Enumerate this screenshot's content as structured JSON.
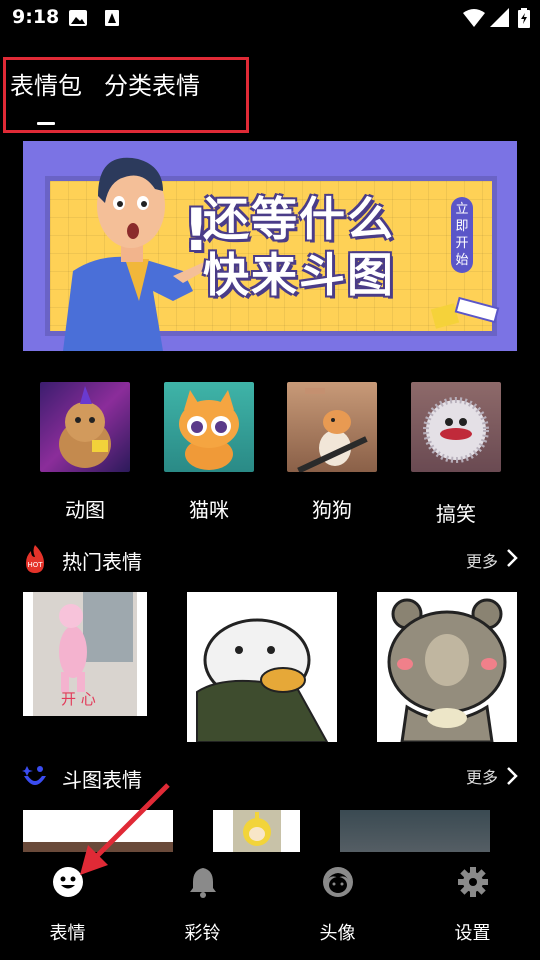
{
  "status_bar": {
    "time": "9:18"
  },
  "tabs": [
    {
      "label": "表情包",
      "active": true
    },
    {
      "label": "分类表情",
      "active": false
    }
  ],
  "banner": {
    "exclamation": "!",
    "line1": "还等什么",
    "line2": "快来斗图",
    "badge": "立即开始"
  },
  "categories": [
    {
      "label": "动图"
    },
    {
      "label": "猫咪"
    },
    {
      "label": "狗狗"
    },
    {
      "label": "搞笑"
    }
  ],
  "hot_section": {
    "title": "热门表情",
    "more": "更多",
    "badge": "HOT",
    "sticker_text": "开 心"
  },
  "battle_section": {
    "title": "斗图表情",
    "more": "更多"
  },
  "bottom_nav": [
    {
      "label": "表情",
      "icon": "smiley-icon"
    },
    {
      "label": "彩铃",
      "icon": "bell-icon"
    },
    {
      "label": "头像",
      "icon": "avatar-icon"
    },
    {
      "label": "设置",
      "icon": "gear-icon"
    }
  ],
  "colors": {
    "highlight": "#e02a36",
    "banner_bg": "#7b73e4",
    "banner_panel": "#fed156",
    "hot_icon": "#e5332a",
    "battle_icon": "#3a4cf0"
  }
}
